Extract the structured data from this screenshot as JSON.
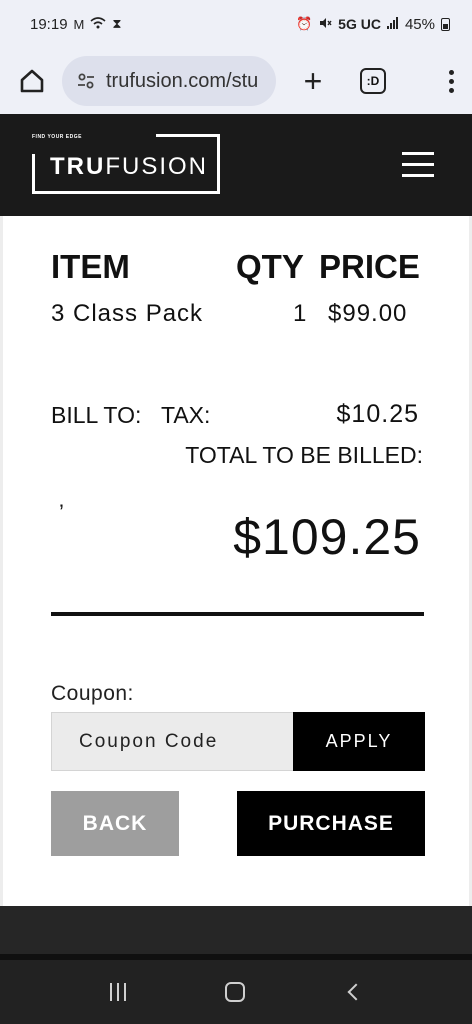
{
  "status_bar": {
    "time": "19:19",
    "left_icons": [
      "gmail-icon",
      "wifi-icon",
      "hourglass-icon"
    ],
    "network": "5G UC",
    "battery": "45%"
  },
  "browser": {
    "url": "trufusion.com/stu",
    "tabs_label": ":D"
  },
  "header": {
    "logo_tagline": "FIND YOUR EDGE",
    "logo_bold": "TRU",
    "logo_light": "FUSION"
  },
  "cart": {
    "col_item": "ITEM",
    "col_qty": "QTY",
    "col_price": "PRICE",
    "items": [
      {
        "name": "3 Class Pack",
        "qty": "1",
        "price": "$99.00"
      }
    ],
    "bill_to_label": "BILL TO:",
    "bill_to_value": "’",
    "tax_label": "TAX:",
    "tax_value": "$10.25",
    "total_label": "TOTAL TO BE BILLED:",
    "total_value": "$109.25"
  },
  "coupon": {
    "label": "Coupon:",
    "placeholder": "Coupon Code",
    "apply_label": "APPLY"
  },
  "actions": {
    "back_label": "BACK",
    "purchase_label": "PURCHASE"
  },
  "colors": {
    "header_bg": "#1a1a1a",
    "back_button": "#9e9e9e",
    "primary_button": "#000000"
  }
}
